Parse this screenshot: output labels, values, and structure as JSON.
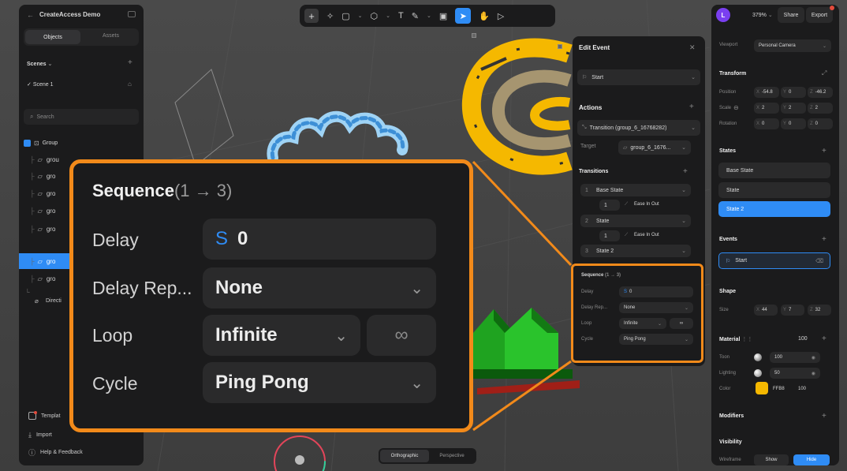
{
  "left_panel": {
    "project_title": "CreateAccess Demo",
    "tabs": [
      "Objects",
      "Assets"
    ],
    "scenes_label": "Scenes",
    "scene_item": "Scene 1",
    "search_placeholder": "Search",
    "group_label": "Group",
    "children": [
      "grou",
      "gro",
      "gro",
      "gro",
      "gro",
      "gro",
      "gro"
    ],
    "direction_item": "Directi",
    "bottom": {
      "templates": "Templat",
      "import": "Import",
      "help": "Help & Feedback"
    }
  },
  "toolbar": {
    "tools": [
      "plus",
      "sparkle",
      "square",
      "shape",
      "text",
      "pen",
      "frame",
      "pointer",
      "hand",
      "play"
    ]
  },
  "edit_event": {
    "title": "Edit Event",
    "trigger": "Start",
    "actions_label": "Actions",
    "action": "Transition (group_6_16768282)",
    "target_label": "Target",
    "target_value": "group_6_1676...",
    "transitions_label": "Transitions",
    "transitions": [
      {
        "index": "1",
        "state": "Base State",
        "duration": "1",
        "ease": "Ease In Out"
      },
      {
        "index": "2",
        "state": "State",
        "duration": "1",
        "ease": "Ease In Out"
      },
      {
        "index": "3",
        "state": "State 2"
      }
    ],
    "sequence": {
      "title": "Sequence",
      "range": "(1 → 3)",
      "delay_label": "Delay",
      "delay_prefix": "S",
      "delay_value": "0",
      "delay_repeat_label": "Delay Rep...",
      "delay_repeat_value": "None",
      "loop_label": "Loop",
      "loop_value": "Infinite",
      "cycle_label": "Cycle",
      "cycle_value": "Ping Pong",
      "infinity_symbol": "∞"
    }
  },
  "right_panel": {
    "avatar_letter": "L",
    "zoom": "379%",
    "share_label": "Share",
    "export_label": "Export",
    "viewport_label": "Viewport",
    "viewport_value": "Personal Camera",
    "transform": {
      "title": "Transform",
      "position_label": "Position",
      "position": [
        "-54.8",
        "0",
        "-46.2"
      ],
      "scale_label": "Scale",
      "scale": [
        "2",
        "2",
        "2"
      ],
      "rotation_label": "Rotation",
      "rotation": [
        "0",
        "0",
        "0"
      ],
      "axes": [
        "X",
        "Y",
        "Z"
      ]
    },
    "states": {
      "title": "States",
      "items": [
        "Base State",
        "State",
        "State 2"
      ],
      "active": "State 2"
    },
    "events": {
      "title": "Events",
      "item": "Start"
    },
    "shape": {
      "title": "Shape",
      "size_label": "Size",
      "size": [
        "44",
        "7",
        "32"
      ]
    },
    "material": {
      "title": "Material",
      "value": "100",
      "toon_label": "Toon",
      "toon_value": "100",
      "lighting_label": "Lighting",
      "lighting_value": "50",
      "color_label": "Color",
      "color_hex": "FFB8",
      "color_opacity": "100",
      "swatch": "#f5b800"
    },
    "modifiers_title": "Modifiers",
    "visibility": {
      "title": "Visibility",
      "wireframe_label": "Wireframe",
      "show_label": "Show",
      "hide_label": "Hide"
    }
  },
  "view_modes": [
    "Orthographic",
    "Perspective"
  ],
  "colors": {
    "accent": "#2f8cf5",
    "callout_border": "#f28a1a",
    "panel_bg": "#1b1b1c"
  }
}
